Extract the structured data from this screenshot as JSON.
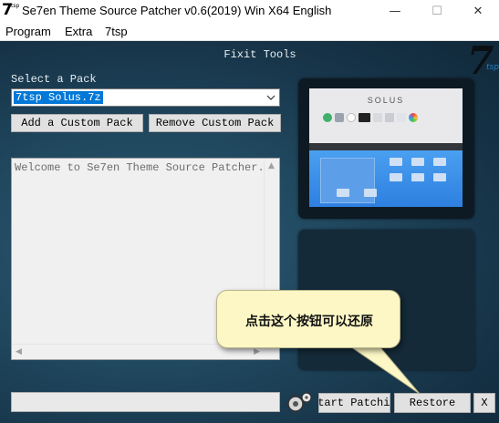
{
  "window": {
    "logo_big": "7",
    "logo_small": "tsp",
    "title": "Se7en Theme Source Patcher v0.6(2019) Win X64 English",
    "minimize_glyph": "—",
    "maximize_glyph": "☐",
    "close_glyph": "✕"
  },
  "menu": {
    "items": [
      "Program",
      "Extra",
      "7tsp"
    ]
  },
  "header": {
    "title": "Fixit Tools",
    "brand_seven": "7",
    "brand_tsp": "tsp"
  },
  "pack": {
    "label": "Select a Pack",
    "selected": "7tsp Solus.7z"
  },
  "buttons": {
    "add": "Add a Custom Pack",
    "remove": "Remove Custom Pack",
    "start": "Start Patching",
    "restore": "Restore",
    "exit": "X"
  },
  "log": {
    "text": "Welcome to Se7en Theme Source Patcher."
  },
  "preview": {
    "brand": "SOLUS"
  },
  "callout": {
    "text": "点击这个按钮可以还原"
  },
  "colors": {
    "background": "#1b3a4e",
    "selection": "#0078d7",
    "callout_fill": "#fcf7c5"
  }
}
